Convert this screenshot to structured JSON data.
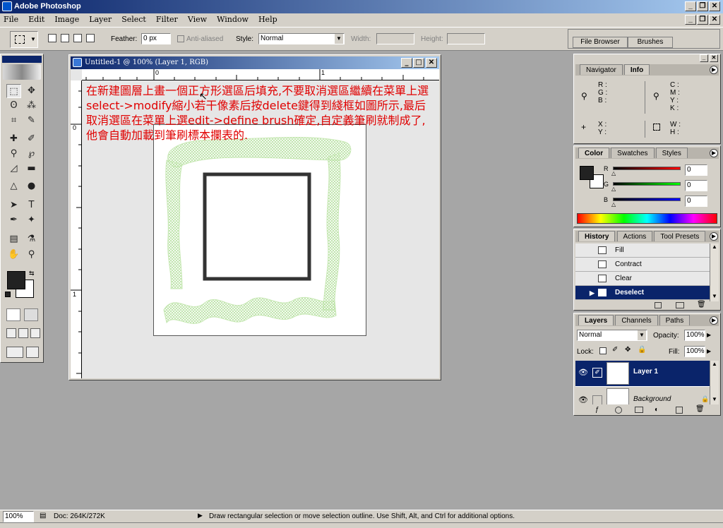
{
  "app": {
    "title": "Adobe Photoshop"
  },
  "menu": [
    "File",
    "Edit",
    "Image",
    "Layer",
    "Select",
    "Filter",
    "View",
    "Window",
    "Help"
  ],
  "options": {
    "feather_label": "Feather:",
    "feather_value": "0 px",
    "antialiased_label": "Anti-aliased",
    "style_label": "Style:",
    "style_value": "Normal",
    "width_label": "Width:",
    "height_label": "Height:",
    "file_browser_tab": "File Browser",
    "brushes_tab": "Brushes"
  },
  "document": {
    "title": "Untitled-1 @ 100% (Layer 1, RGB)",
    "ruler_top": [
      "0",
      "1"
    ],
    "ruler_left": [
      "0",
      "1"
    ],
    "annotation": "在新建圖層上畫一個正方形選區后填充,不要取消選區繼續在菜單上選select->modify縮小若干像素后按delete鍵得到綫框如圖所示,最后取消選區在菜單上選edit->define brush確定,自定義筆刷就制成了,他會自動加載到筆刷標本攔表的."
  },
  "navigator": {
    "tabs": [
      "Navigator",
      "Info"
    ],
    "rgb": [
      "R :",
      "G :",
      "B :"
    ],
    "cmyk": [
      "C :",
      "M :",
      "Y :",
      "K :"
    ],
    "xy": [
      "X :",
      "Y :"
    ],
    "wh": [
      "W :",
      "H :"
    ]
  },
  "color": {
    "tabs": [
      "Color",
      "Swatches",
      "Styles"
    ],
    "r_label": "R",
    "g_label": "G",
    "b_label": "B",
    "r_value": "0",
    "g_value": "0",
    "b_value": "0",
    "foreground": "#222222",
    "background": "#ffffff"
  },
  "history": {
    "tabs": [
      "History",
      "Actions",
      "Tool Presets"
    ],
    "items": [
      "Fill",
      "Contract",
      "Clear",
      "Deselect"
    ]
  },
  "layers": {
    "tabs": [
      "Layers",
      "Channels",
      "Paths"
    ],
    "blend_mode": "Normal",
    "opacity_label": "Opacity:",
    "opacity_value": "100%",
    "lock_label": "Lock:",
    "fill_label": "Fill:",
    "fill_value": "100%",
    "items": [
      "Layer 1",
      "Background"
    ]
  },
  "status": {
    "zoom": "100%",
    "doc": "Doc: 264K/272K",
    "hint": "Draw rectangular selection or move selection outline.  Use Shift, Alt, and Ctrl for additional options."
  }
}
